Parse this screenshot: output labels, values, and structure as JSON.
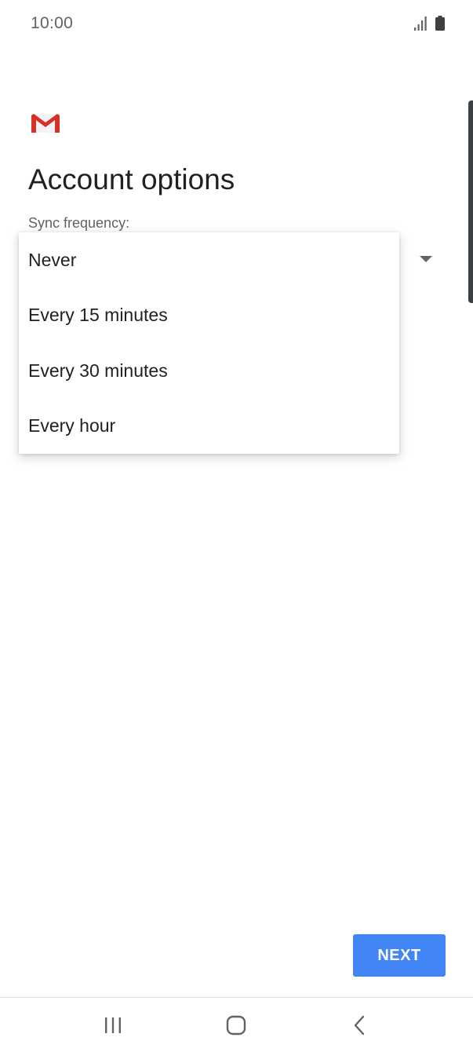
{
  "status_bar": {
    "time": "10:00"
  },
  "header": {
    "logo_icon": "gmail-logo-icon",
    "title": "Account options"
  },
  "sync": {
    "label": "Sync frequency:",
    "options": [
      "Never",
      "Every 15 minutes",
      "Every 30 minutes",
      "Every hour"
    ]
  },
  "actions": {
    "next_label": "NEXT"
  },
  "colors": {
    "accent": "#4285f4",
    "gmail_red": "#d93025",
    "text_primary": "#202124",
    "text_secondary": "#5f6368"
  },
  "nav": {
    "recents_icon": "recents-icon",
    "home_icon": "home-icon",
    "back_icon": "back-icon"
  }
}
